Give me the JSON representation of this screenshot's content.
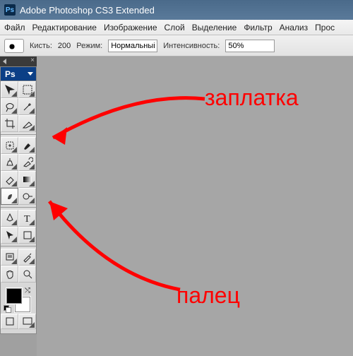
{
  "titlebar": {
    "title": "Adobe Photoshop CS3 Extended",
    "icon_text": "Ps"
  },
  "menu": {
    "file": "Файл",
    "edit": "Редактирование",
    "image": "Изображение",
    "layer": "Слой",
    "select": "Выделение",
    "filter": "Фильтр",
    "analysis": "Анализ",
    "view": "Прос"
  },
  "options": {
    "brush_label": "Кисть:",
    "brush_size": "200",
    "mode_label": "Режим:",
    "mode_value": "Нормальный",
    "intensity_label": "Интенсивность:",
    "intensity_value": "50%"
  },
  "toolbox": {
    "logo": "Ps"
  },
  "annotations": {
    "patch": "заплатка",
    "smudge": "палец"
  }
}
